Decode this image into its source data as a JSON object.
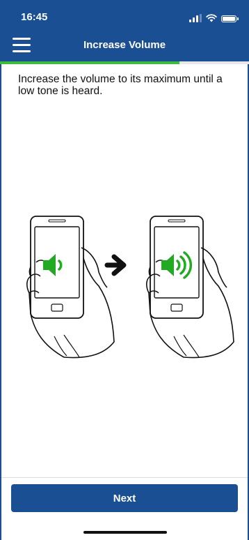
{
  "status_bar": {
    "time": "16:45"
  },
  "header": {
    "title": "Increase Volume",
    "menu_icon": "hamburger-menu-icon"
  },
  "progress": {
    "fraction": 0.72,
    "color": "#3dbb3d"
  },
  "content": {
    "instruction": "Increase the volume to its maximum until a low tone is heard.",
    "illustration": {
      "left_icon": "speaker-low-volume-icon",
      "arrow_icon": "right-arrow-icon",
      "right_icon": "speaker-high-volume-icon",
      "speaker_color": "#22aa22"
    }
  },
  "footer": {
    "next_label": "Next"
  },
  "colors": {
    "brand": "#1b4f93",
    "accent": "#3dbb3d"
  }
}
